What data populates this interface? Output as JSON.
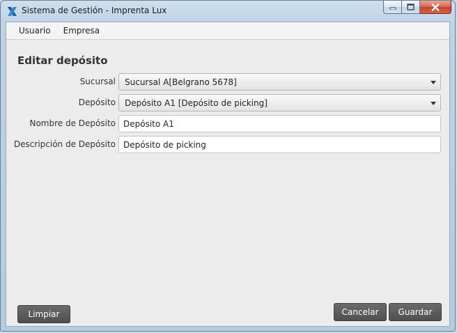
{
  "window": {
    "title": "Sistema de Gestión - Imprenta Lux",
    "app_icon": "x-logo-icon",
    "caption_buttons": [
      "minimize-icon",
      "maximize-icon",
      "close-icon"
    ]
  },
  "menubar": {
    "items": [
      {
        "label": "Usuario"
      },
      {
        "label": "Empresa"
      }
    ]
  },
  "form": {
    "title": "Editar depósito",
    "sucursal": {
      "label": "Sucursal",
      "value": "Sucursal A[Belgrano 5678]"
    },
    "deposito": {
      "label": "Depósito",
      "value": "Depósito A1 [Depósito de picking]"
    },
    "nombre": {
      "label": "Nombre de Depósito",
      "value": "Depósito A1"
    },
    "descripcion": {
      "label": "Descripción de Depósito",
      "value": "Depósito de picking"
    }
  },
  "buttons": {
    "limpiar": "Limpiar",
    "cancelar": "Cancelar",
    "guardar": "Guardar"
  },
  "colors": {
    "button_bg": "#5a5a5a",
    "client_bg": "#ececec",
    "close_button": "#c7432b"
  }
}
